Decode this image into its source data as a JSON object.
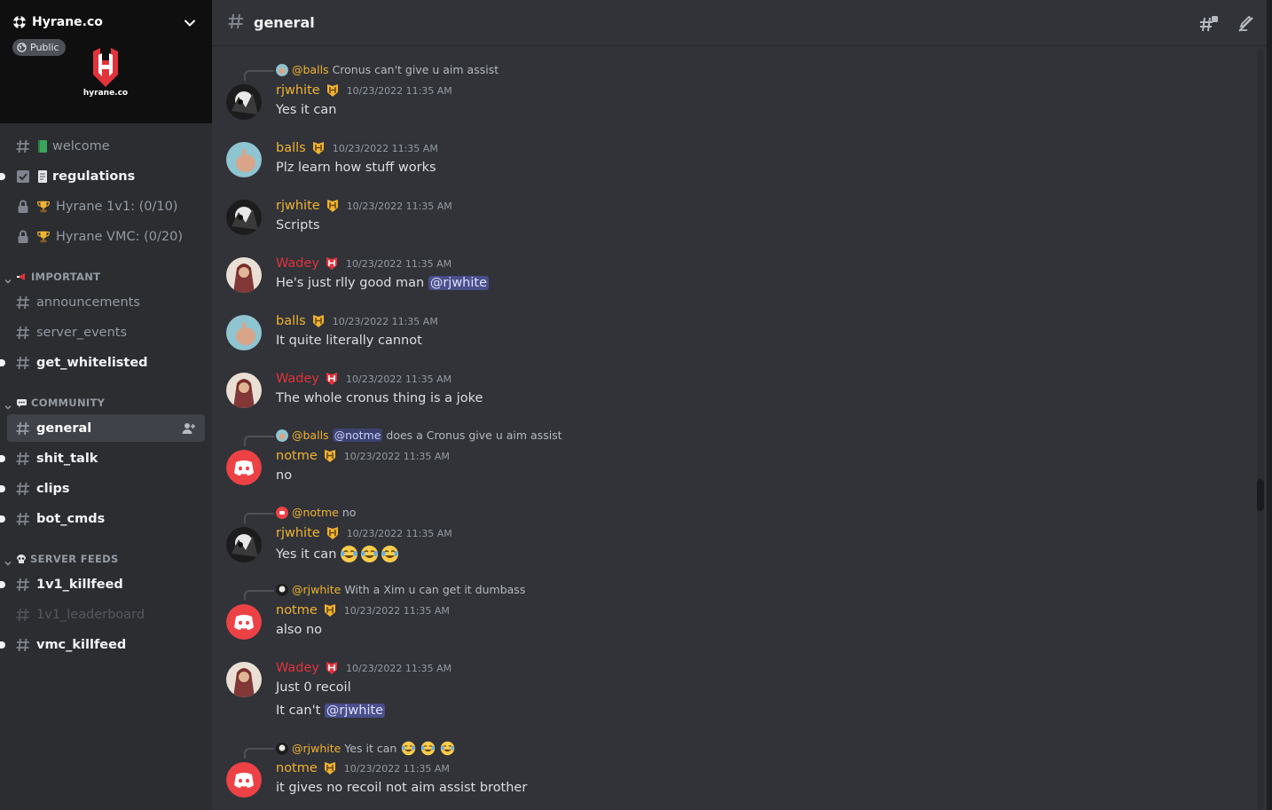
{
  "server": {
    "name": "Hyrane.co",
    "public_label": "Public",
    "logo_text": "hyrane.co",
    "brand_color": "#e0333c"
  },
  "sidebar": {
    "channels_top": [
      {
        "name": "welcome",
        "icon": "hash-icon",
        "emoji": "green-book-emoji",
        "state": "normal"
      },
      {
        "name": "regulations",
        "icon": "rules-checkbox-icon",
        "emoji": "page-emoji",
        "state": "unread"
      },
      {
        "name": "Hyrane 1v1: (0/10)",
        "icon": "lock-icon",
        "emoji": "trophy-emoji",
        "state": "normal"
      },
      {
        "name": "Hyrane VMC: (0/20)",
        "icon": "lock-icon",
        "emoji": "trophy-emoji",
        "state": "normal"
      }
    ],
    "categories": [
      {
        "label": "IMPORTANT",
        "icon": "megaphone-icon",
        "channels": [
          {
            "name": "announcements",
            "state": "normal"
          },
          {
            "name": "server_events",
            "state": "normal"
          },
          {
            "name": "get_whitelisted",
            "state": "unread"
          }
        ]
      },
      {
        "label": "COMMUNITY",
        "icon": "speech-bubble-icon",
        "channels": [
          {
            "name": "general",
            "state": "active"
          },
          {
            "name": "shit_talk",
            "state": "unread"
          },
          {
            "name": "clips",
            "state": "unread"
          },
          {
            "name": "bot_cmds",
            "state": "unread"
          }
        ]
      },
      {
        "label": "SERVER FEEDS",
        "icon": "skull-icon",
        "channels": [
          {
            "name": "1v1_killfeed",
            "state": "unread"
          },
          {
            "name": "1v1_leaderboard",
            "state": "muted"
          },
          {
            "name": "vmc_killfeed",
            "state": "unread"
          }
        ]
      }
    ]
  },
  "header": {
    "channel_name": "general"
  },
  "colors": {
    "yellow_role": "#f0b232",
    "red_role": "#e0333c",
    "mention_bg": "#4a4e8a"
  },
  "messages": [
    {
      "reply": {
        "author": "@balls",
        "text": "Cronus can't give u aim assist"
      },
      "author": "rjwhite",
      "timestamp": "10/23/2022 11:35 AM",
      "lines": [
        "Yes it can"
      ]
    },
    {
      "author": "balls",
      "timestamp": "10/23/2022 11:35 AM",
      "lines": [
        "Plz learn how stuff works"
      ]
    },
    {
      "author": "rjwhite",
      "timestamp": "10/23/2022 11:35 AM",
      "lines": [
        "Scripts"
      ]
    },
    {
      "author": "Wadey",
      "timestamp": "10/23/2022 11:35 AM",
      "text": "He's just rlly good man",
      "mention": "@rjwhite"
    },
    {
      "author": "balls",
      "timestamp": "10/23/2022 11:35 AM",
      "lines": [
        "It quite literally cannot"
      ]
    },
    {
      "author": "Wadey",
      "timestamp": "10/23/2022 11:35 AM",
      "lines": [
        "The whole cronus thing is a joke"
      ]
    },
    {
      "reply": {
        "author": "@balls",
        "mention": "@notme",
        "text": "does a Cronus give u aim assist"
      },
      "author": "notme",
      "timestamp": "10/23/2022 11:35 AM",
      "lines": [
        "no"
      ]
    },
    {
      "reply": {
        "author": "@notme",
        "text": "no"
      },
      "author": "rjwhite",
      "timestamp": "10/23/2022 11:35 AM",
      "text": "Yes it can"
    },
    {
      "reply": {
        "author": "@rjwhite",
        "text": "With a Xim u can get it dumbass"
      },
      "author": "notme",
      "timestamp": "10/23/2022 11:35 AM",
      "lines": [
        "also no"
      ]
    },
    {
      "author": "Wadey",
      "timestamp": "10/23/2022 11:35 AM",
      "lines": [
        "Just 0 recoil"
      ],
      "line2_text": "It can't",
      "line2_mention": "@rjwhite"
    },
    {
      "reply": {
        "author": "@rjwhite",
        "text": "Yes it can"
      },
      "author": "notme",
      "timestamp": "10/23/2022 11:35 AM",
      "lines": [
        "it gives no recoil not aim assist brother"
      ]
    }
  ]
}
